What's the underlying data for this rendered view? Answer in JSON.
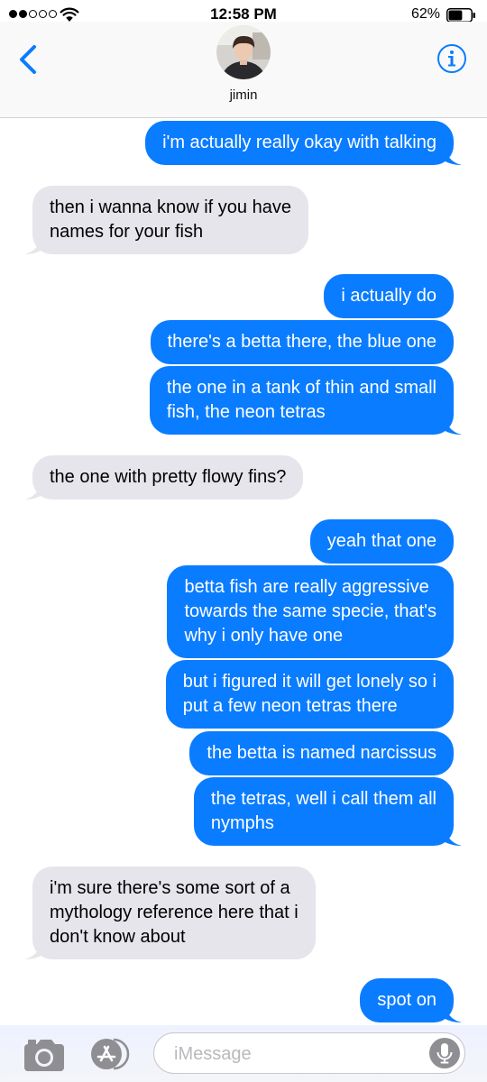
{
  "status_bar": {
    "time": "12:58 PM",
    "battery_percent": "62%",
    "battery_level": 0.62,
    "signal_bars_filled": 2,
    "signal_bars_total": 5
  },
  "header": {
    "back_icon": "chevron-left-icon",
    "contact_name": "jimin",
    "info_icon": "info-icon"
  },
  "messages": [
    {
      "side": "sent",
      "lines": [
        "i'm actually really okay with talking"
      ],
      "tail": true
    },
    {
      "side": "recv",
      "lines": [
        "then i wanna know if you have",
        "names for your fish"
      ],
      "tail": true
    },
    {
      "side": "sent",
      "lines": [
        "i actually do"
      ],
      "tail": false
    },
    {
      "side": "sent",
      "lines": [
        "there's a betta there, the blue one"
      ],
      "tail": false
    },
    {
      "side": "sent",
      "lines": [
        "the one in a tank of thin and small",
        "fish, the neon tetras"
      ],
      "tail": true
    },
    {
      "side": "recv",
      "lines": [
        "the one with pretty flowy fins?"
      ],
      "tail": true
    },
    {
      "side": "sent",
      "lines": [
        "yeah that one"
      ],
      "tail": false
    },
    {
      "side": "sent",
      "lines": [
        "betta fish are really aggressive",
        "towards the same specie, that's",
        "why i only have one"
      ],
      "tail": false
    },
    {
      "side": "sent",
      "lines": [
        "but i figured it will get lonely so i",
        "put a few neon tetras there"
      ],
      "tail": false
    },
    {
      "side": "sent",
      "lines": [
        "the betta is named narcissus"
      ],
      "tail": false
    },
    {
      "side": "sent",
      "lines": [
        "the tetras, well i call them all",
        "nymphs"
      ],
      "tail": true
    },
    {
      "side": "recv",
      "lines": [
        "i'm sure there's some sort of a",
        "mythology reference here that i",
        "don't know about"
      ],
      "tail": true
    },
    {
      "side": "sent",
      "lines": [
        "spot on"
      ],
      "tail": true
    }
  ],
  "input_bar": {
    "placeholder": "iMessage",
    "value": "",
    "camera_icon": "camera-icon",
    "apps_icon": "app-store-icon",
    "mic_icon": "microphone-icon"
  },
  "colors": {
    "sent_bubble": "#0a7cff",
    "received_bubble": "#e6e5eb",
    "accent": "#0a7cff"
  }
}
